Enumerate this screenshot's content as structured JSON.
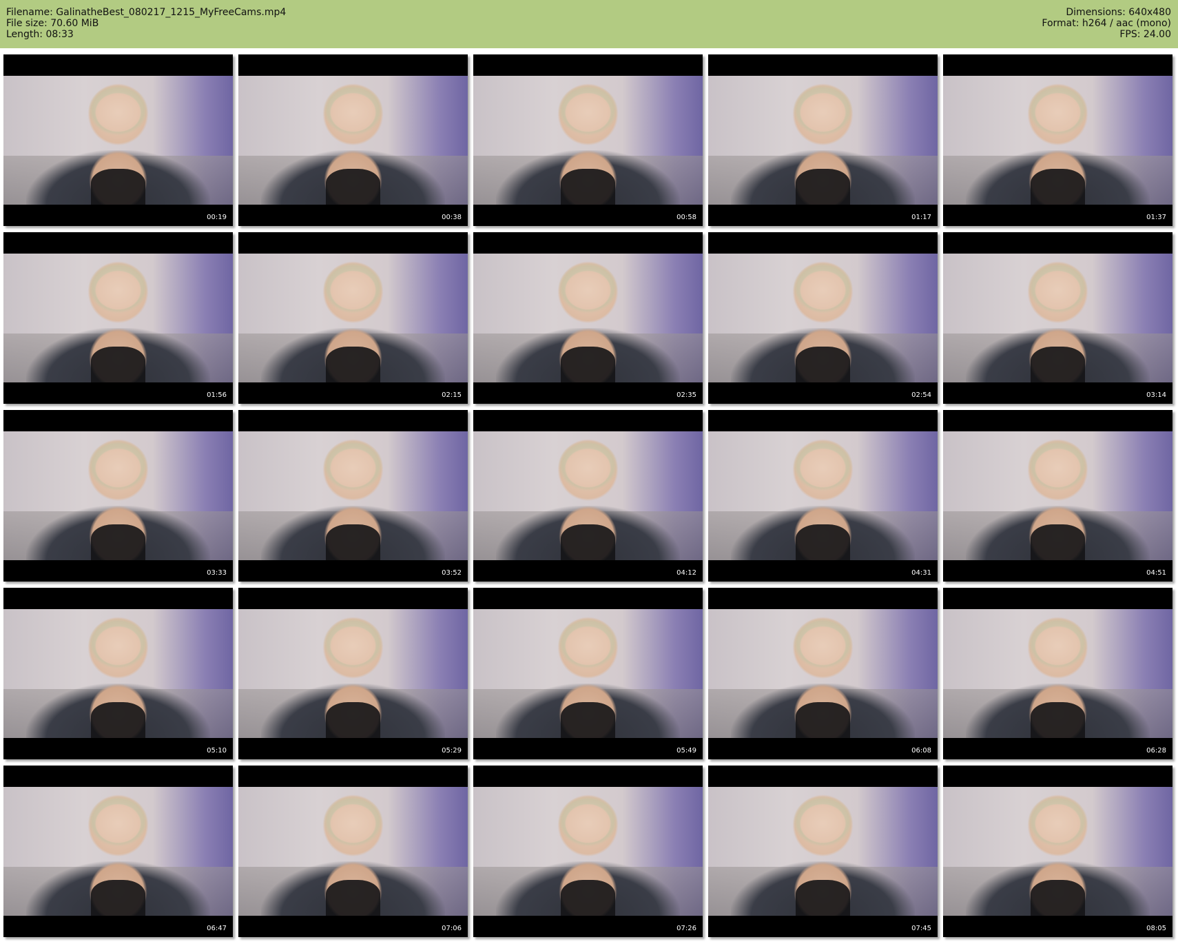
{
  "header": {
    "filename": "Filename: GalinatheBest_080217_1215_MyFreeCams.mp4",
    "filesize": "File size: 70.60 MiB",
    "length": "Length: 08:33",
    "dimensions": "Dimensions: 640x480",
    "format": "Format: h264 / aac (mono)",
    "fps": "FPS: 24.00"
  },
  "colors": {
    "header_background": "#b2cb82",
    "page_background": "#ffffff"
  },
  "thumbnails": [
    {
      "timestamp": "00:19"
    },
    {
      "timestamp": "00:38"
    },
    {
      "timestamp": "00:58"
    },
    {
      "timestamp": "01:17"
    },
    {
      "timestamp": "01:37"
    },
    {
      "timestamp": "01:56"
    },
    {
      "timestamp": "02:15"
    },
    {
      "timestamp": "02:35"
    },
    {
      "timestamp": "02:54"
    },
    {
      "timestamp": "03:14"
    },
    {
      "timestamp": "03:33"
    },
    {
      "timestamp": "03:52"
    },
    {
      "timestamp": "04:12"
    },
    {
      "timestamp": "04:31"
    },
    {
      "timestamp": "04:51"
    },
    {
      "timestamp": "05:10"
    },
    {
      "timestamp": "05:29"
    },
    {
      "timestamp": "05:49"
    },
    {
      "timestamp": "06:08"
    },
    {
      "timestamp": "06:28"
    },
    {
      "timestamp": "06:47"
    },
    {
      "timestamp": "07:06"
    },
    {
      "timestamp": "07:26"
    },
    {
      "timestamp": "07:45"
    },
    {
      "timestamp": "08:05"
    }
  ]
}
